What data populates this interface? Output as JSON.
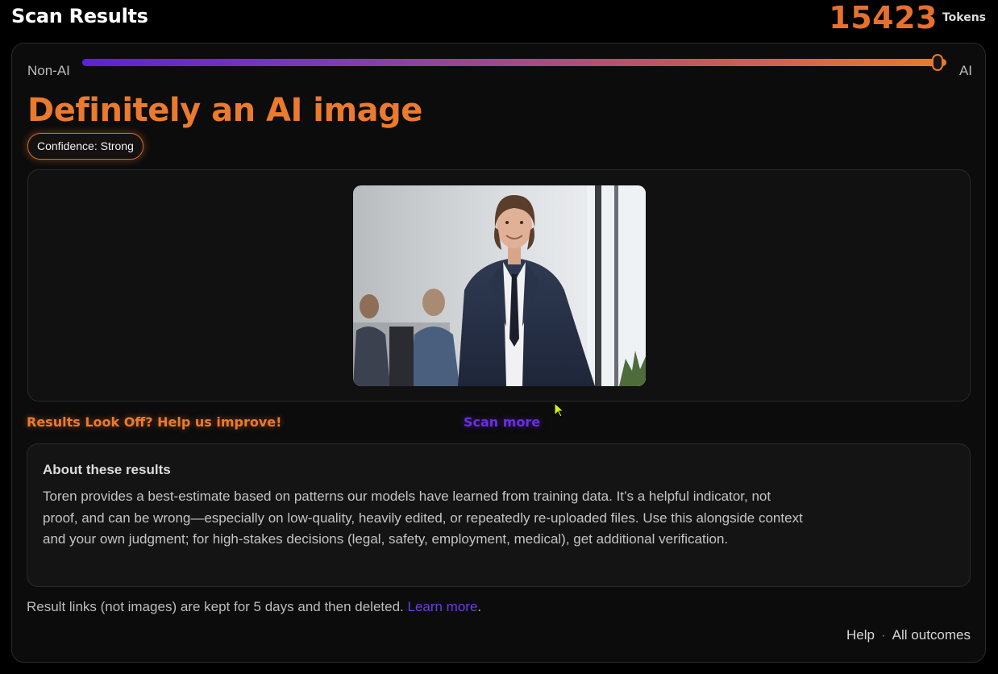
{
  "header": {
    "title": "Scan Results",
    "token_count": "15423",
    "token_label": "Tokens"
  },
  "scale": {
    "left_label": "Non-AI",
    "right_label": "AI",
    "ai_probability_percent": 99
  },
  "result": {
    "verdict": "Definitely an AI image",
    "confidence": "Confidence: Strong"
  },
  "image": {
    "subject": "woman-in-business-suit-photo"
  },
  "actions": {
    "feedback": "Results Look Off? Help us improve!",
    "scan_more": "Scan more"
  },
  "about": {
    "title": "About these results",
    "body": "Toren provides a best-estimate based on patterns our models have learned from training data. It’s a helpful indicator, not proof, and can be wrong—especially on low-quality, heavily edited, or repeatedly re-uploaded files. Use this alongside context and your own judgment; for high-stakes decisions (legal, safety, employment, medical), get additional verification."
  },
  "retention": {
    "text": "Result links (not images) are kept for 5 days and then deleted. ",
    "link": "Learn more",
    "suffix": "."
  },
  "footer": {
    "help": "Help",
    "separator": "·",
    "all_outcomes": "All outcomes"
  },
  "colors": {
    "accent_orange": "#ea7a2e",
    "accent_purple": "#6a2fe0",
    "background": "#000000"
  }
}
